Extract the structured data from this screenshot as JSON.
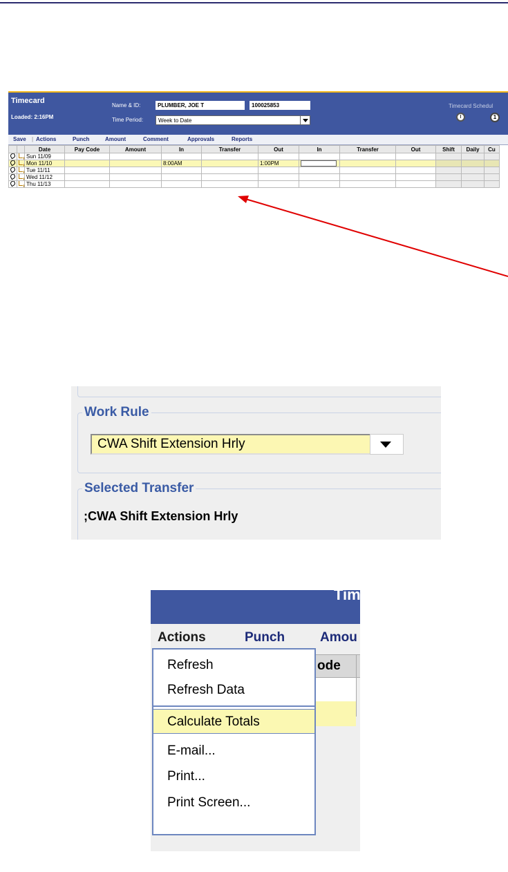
{
  "timecard": {
    "title": "Timecard",
    "loaded": "Loaded: 2:16PM",
    "name_label": "Name & ID:",
    "name_value": "PLUMBER, JOE T",
    "id_value": "100025853",
    "period_label": "Time Period:",
    "period_value": "Week to Date",
    "tabs_label": "Timecard  Schedul",
    "schedule_icon_text": "1",
    "menu": [
      "Save",
      "Actions",
      "Punch",
      "Amount",
      "Comment",
      "Approvals",
      "Reports"
    ],
    "columns": [
      "Date",
      "Pay Code",
      "Amount",
      "In",
      "Transfer",
      "Out",
      "In",
      "Transfer",
      "Out",
      "Shift",
      "Daily",
      "Cu"
    ],
    "rows": [
      {
        "date": "Sun 11/09",
        "in1": "",
        "out1": ""
      },
      {
        "date": "Mon 11/10",
        "in1": "8:00AM",
        "out1": "1:00PM"
      },
      {
        "date": "Tue 11/11",
        "in1": "",
        "out1": ""
      },
      {
        "date": "Wed 11/12",
        "in1": "",
        "out1": ""
      },
      {
        "date": "Thu 11/13",
        "in1": "",
        "out1": ""
      }
    ]
  },
  "work_rule": {
    "label": "Work Rule",
    "value": "CWA Shift Extension Hrly",
    "transfer_label": "Selected Transfer",
    "transfer_value": ";CWA Shift Extension Hrly"
  },
  "actions_menu": {
    "header_fragment": "Tim",
    "menubar": [
      "Actions",
      "Punch",
      "Amou"
    ],
    "column_fragment": "ode",
    "items": [
      "Refresh",
      "Refresh Data",
      "Calculate Totals",
      "E-mail...",
      "Print...",
      "Print Screen..."
    ]
  },
  "colors": {
    "header_blue": "#3f57a0",
    "highlight_yellow": "#fbf8b6",
    "annotation_red": "#e00000"
  }
}
